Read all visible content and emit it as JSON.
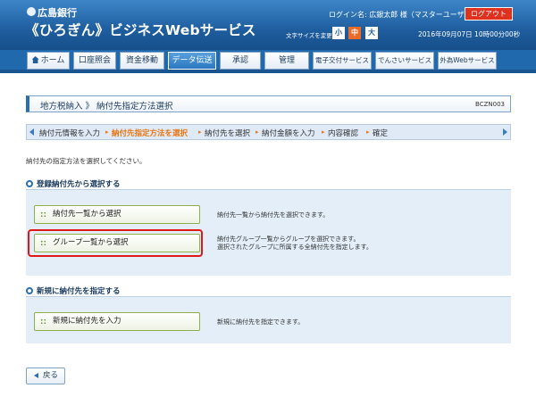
{
  "header": {
    "bank_name": "広島銀行",
    "service_name": "《ひろぎん》ビジネスWebサービス",
    "login_label": "ログイン名: 広銀太郎 様（マスターユーザ）",
    "logout_label": "ログアウト",
    "font_size_label": "文字サイズを変更",
    "font_sizes": [
      "小",
      "中",
      "大"
    ],
    "datetime": "2016年09月07日 10時00分00秒"
  },
  "nav": {
    "items": [
      "ホーム",
      "口座照会",
      "資金移動",
      "データ伝送",
      "承認",
      "管理",
      "電子交付サービス",
      "でんさいサービス",
      "外為Webサービス"
    ],
    "active_index": 3
  },
  "page": {
    "title": "地方税納入 》 納付先指定方法選択",
    "screen_id": "BCZN003",
    "instruction": "納付先の指定方法を選択してください。"
  },
  "steps": {
    "items": [
      "納付元情報を入力",
      "納付先指定方法を選択",
      "納付先を選択",
      "納付金額を入力",
      "内容確認",
      "確定"
    ],
    "current_index": 1
  },
  "section_registered": {
    "heading": "登録納付先から選択する",
    "list_button": "納付先一覧から選択",
    "list_desc": "納付先一覧から納付先を選択できます。",
    "group_button": "グループ一覧から選択",
    "group_desc_line1": "納付先グループ一覧からグループを選択できます。",
    "group_desc_line2": "選択されたグループに所属する全納付先を指定します。"
  },
  "section_new": {
    "heading": "新規に納付先を指定する",
    "new_button": "新規に納付先を入力",
    "new_desc": "新規に納付先を指定できます。"
  },
  "footer": {
    "back_label": "戻る"
  },
  "colors": {
    "header_blue": "#1e5d9e",
    "logout_red": "#e0301e",
    "current_step_orange": "#e87511",
    "highlight_red": "#e01818"
  }
}
